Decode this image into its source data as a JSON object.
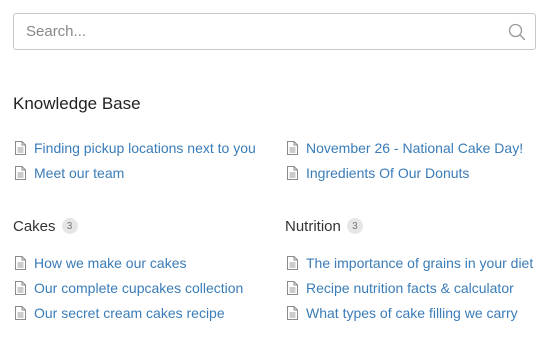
{
  "search": {
    "placeholder": "Search...",
    "value": "",
    "icon": "search-icon"
  },
  "knowledge_base": {
    "title": "Knowledge Base",
    "left": [
      {
        "label": "Finding pickup locations next to you",
        "icon": "document-icon"
      },
      {
        "label": "Meet our team",
        "icon": "document-icon"
      }
    ],
    "right": [
      {
        "label": "November 26 - National Cake Day!",
        "icon": "document-icon"
      },
      {
        "label": "Ingredients Of Our Donuts",
        "icon": "document-icon"
      }
    ]
  },
  "categories": [
    {
      "title": "Cakes",
      "count": "3",
      "articles": [
        {
          "label": "How we make our cakes",
          "icon": "document-icon"
        },
        {
          "label": "Our complete cupcakes collection",
          "icon": "document-icon"
        },
        {
          "label": "Our secret cream cakes recipe",
          "icon": "document-icon"
        }
      ]
    },
    {
      "title": "Nutrition",
      "count": "3",
      "articles": [
        {
          "label": "The importance of grains in your diet",
          "icon": "document-icon"
        },
        {
          "label": "Recipe nutrition facts & calculator",
          "icon": "document-icon"
        },
        {
          "label": "What types of cake filling we carry",
          "icon": "document-icon"
        }
      ]
    }
  ],
  "colors": {
    "link": "#3a7cb8",
    "text": "#333333",
    "border": "#c8c8c8",
    "badge_bg": "#e6e6e6"
  }
}
